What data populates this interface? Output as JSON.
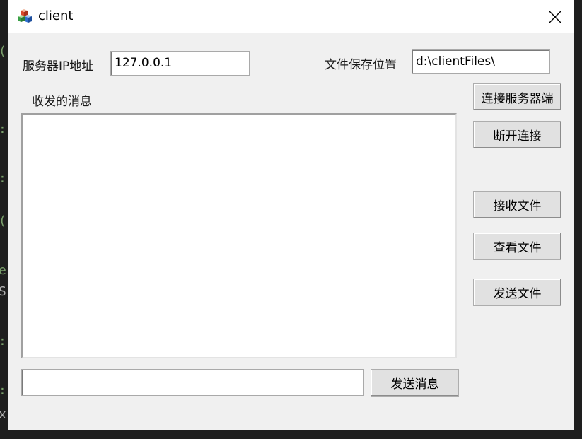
{
  "window": {
    "title": "client",
    "close_glyph": "✕"
  },
  "server_ip": {
    "label": "服务器IP地址",
    "value": "127.0.0.1"
  },
  "save_location": {
    "label": "文件保存位置",
    "value": "d:\\clientFiles\\"
  },
  "messages": {
    "label": "收发的消息",
    "content": ""
  },
  "input": {
    "value": ""
  },
  "buttons": {
    "connect": "连接服务器端",
    "disconnect": "断开连接",
    "receive_file": "接收文件",
    "view_file": "查看文件",
    "send_file": "发送文件",
    "send_message": "发送消息"
  },
  "icons": {
    "app": "app-cubes-icon",
    "close": "close-icon"
  }
}
